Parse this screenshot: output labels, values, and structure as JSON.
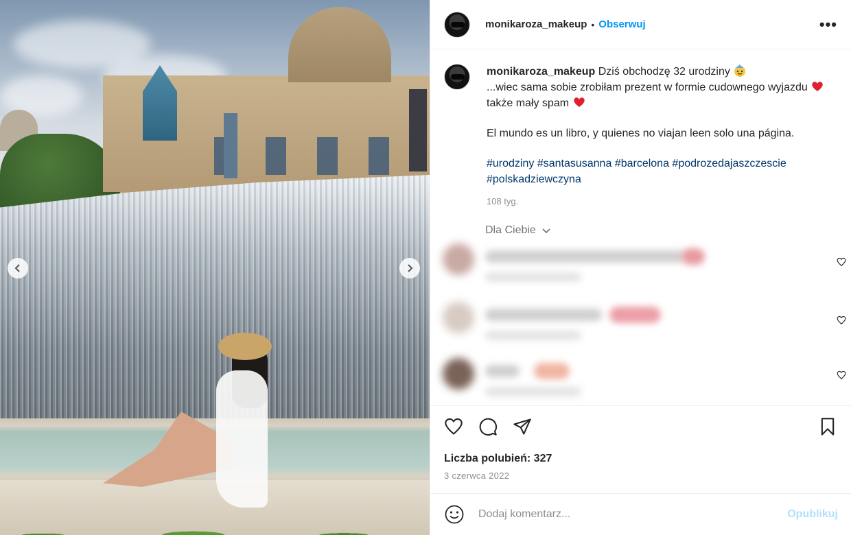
{
  "post": {
    "username": "monikaroza_makeup",
    "separator": "•",
    "follow_label": "Obserwuj",
    "more_label": "•••"
  },
  "caption": {
    "username": "monikaroza_makeup",
    "line1": "Dziś obchodzę 32 urodziny",
    "line2": "...wiec sama sobie zrobiłam prezent w formie cudownego wyjazdu",
    "line2b": "także mały spam",
    "line3": "El mundo es un libro, y quienes no viajan leen solo una página.",
    "tags": "#urodziny #santasusanna #barcelona #podrozedajaszczescie #polskadziewczyna",
    "time_ago": "108 tyg.",
    "emoji_birthday": "face-with-party-icon",
    "emoji_heart": "red-heart-icon"
  },
  "comments": {
    "filter_label": "Dla Ciebie",
    "items": [
      {
        "blurred": true
      },
      {
        "blurred": true
      },
      {
        "blurred": true
      }
    ]
  },
  "actions": {
    "likes_label": "Liczba polubień: 327",
    "date": "3 czerwca 2022"
  },
  "comment_box": {
    "placeholder": "Dodaj komentarz...",
    "publish_label": "Opublikuj"
  },
  "colors": {
    "accent": "#0095f6",
    "tag": "#00376b",
    "muted": "#8e8e8e",
    "publish_disabled": "#b3dffc"
  }
}
